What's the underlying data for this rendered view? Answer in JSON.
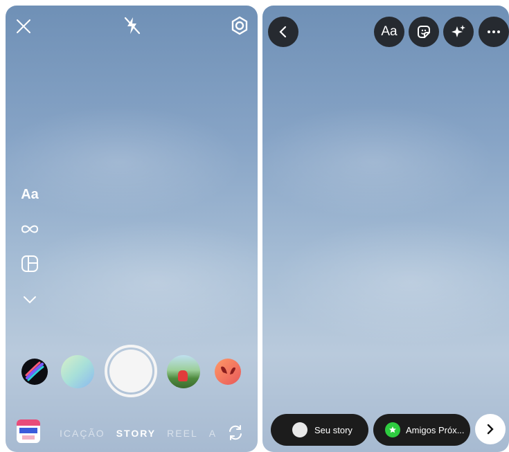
{
  "camera": {
    "side_tools": {
      "text_tool": "Aa"
    },
    "modes": {
      "left_cut": "ICAÇÃO",
      "active": "STORY",
      "next": "REEL",
      "right_cut": "A"
    },
    "icons": {
      "close": "close-icon",
      "flash": "flash-off-icon",
      "settings": "settings-icon",
      "boomerang": "infinity-icon",
      "layout": "layout-icon",
      "more": "chevron-down-icon",
      "flip": "flip-camera-icon"
    }
  },
  "editor": {
    "toolbar": {
      "text_button": "Aa"
    },
    "share": {
      "your_story": "Seu story",
      "close_friends": "Amigos Próx..."
    },
    "colors": {
      "close_friends_badge": "#2ecc40",
      "pill_bg": "#1c1c1c"
    }
  }
}
